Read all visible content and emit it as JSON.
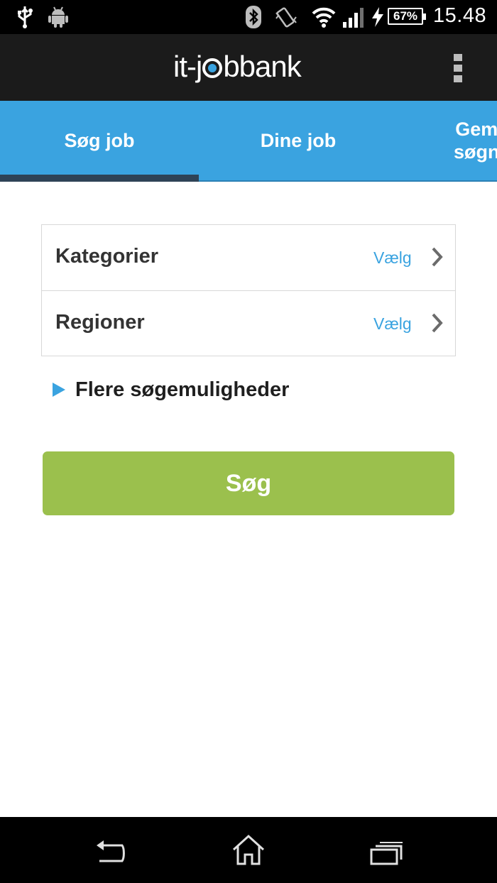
{
  "status_bar": {
    "battery": "67%",
    "time": "15.48",
    "icons": [
      "usb-icon",
      "android-debug-icon",
      "bluetooth-icon",
      "vibrate-icon",
      "wifi-icon",
      "signal-icon",
      "charging-icon",
      "battery-icon"
    ]
  },
  "app_bar": {
    "logo_part1": "it-j",
    "logo_part2": "bbank",
    "menu_icon": "overflow-menu-icon"
  },
  "tabs": [
    {
      "label": "Søg job"
    },
    {
      "label": "Dine job"
    },
    {
      "label": "Gem\nsøgn"
    }
  ],
  "form": {
    "rows": [
      {
        "label": "Kategorier",
        "value": "Vælg"
      },
      {
        "label": "Regioner",
        "value": "Vælg"
      }
    ],
    "more_options": "Flere søgemuligheder",
    "search_button": "Søg"
  },
  "colors": {
    "accent": "#3aa3e0",
    "tab_indicator": "#2e4356",
    "button": "#9bc04d",
    "app_bar": "#1b1b1b"
  },
  "nav_bar": {
    "icons": [
      "back-icon",
      "home-icon",
      "recent-apps-icon"
    ]
  }
}
